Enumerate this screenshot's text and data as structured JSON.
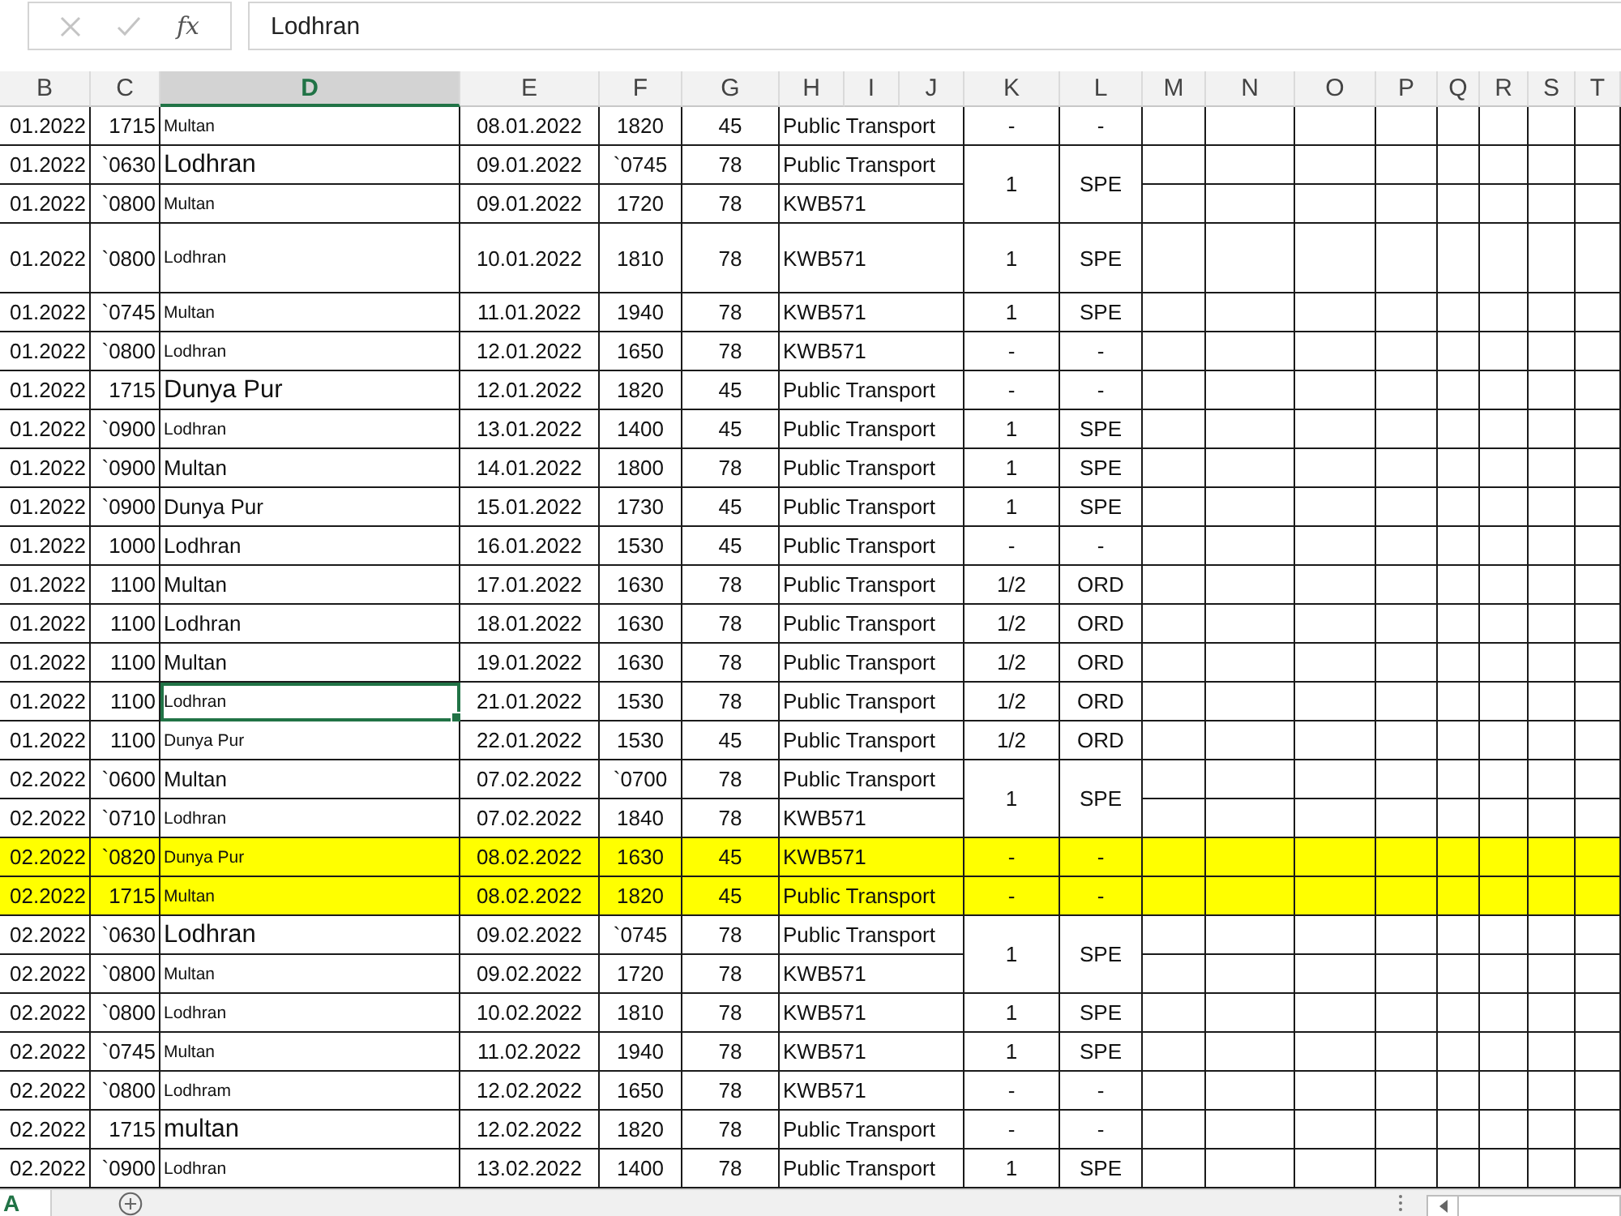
{
  "formula_bar": {
    "function_label": "fx",
    "value": "Lodhran"
  },
  "columns": [
    {
      "label": "B",
      "selected": false
    },
    {
      "label": "C",
      "selected": false
    },
    {
      "label": "D",
      "selected": true
    },
    {
      "label": "E",
      "selected": false
    },
    {
      "label": "F",
      "selected": false
    },
    {
      "label": "G",
      "selected": false
    },
    {
      "label": "H",
      "selected": false
    },
    {
      "label": "I",
      "selected": false
    },
    {
      "label": "J",
      "selected": false
    },
    {
      "label": "K",
      "selected": false
    },
    {
      "label": "L",
      "selected": false
    },
    {
      "label": "M",
      "selected": false
    },
    {
      "label": "N",
      "selected": false
    },
    {
      "label": "O",
      "selected": false
    },
    {
      "label": "P",
      "selected": false
    },
    {
      "label": "Q",
      "selected": false
    },
    {
      "label": "R",
      "selected": false
    },
    {
      "label": "S",
      "selected": false
    },
    {
      "label": "T",
      "selected": false
    }
  ],
  "rows": [
    {
      "b": "01.2022",
      "c": "1715",
      "d": "Multan",
      "kind": "small",
      "e": "08.01.2022",
      "f": "1820",
      "g": "45",
      "h": "Public Transport",
      "k": "-",
      "l": "-",
      "kl_merged": false,
      "tall": false,
      "highlighted": false,
      "selected": false
    },
    {
      "b": "01.2022",
      "c": "`0630",
      "d": "Lodhran",
      "kind": "large",
      "e": "09.01.2022",
      "f": "`0745",
      "g": "78",
      "h": "Public Transport",
      "k": "1",
      "l": "SPE",
      "kl_merged": true,
      "tall": false,
      "highlighted": false,
      "selected": false
    },
    {
      "b": "01.2022",
      "c": "`0800",
      "d": "Multan",
      "kind": "small",
      "e": "09.01.2022",
      "f": "1720",
      "g": "78",
      "h": "KWB571",
      "kl_merged": false,
      "tall": false,
      "highlighted": false,
      "selected": false
    },
    {
      "b": "01.2022",
      "c": "`0800",
      "d": "Lodhran",
      "kind": "small",
      "e": "10.01.2022",
      "f": "1810",
      "g": "78",
      "h": "KWB571",
      "k": "1",
      "l": "SPE",
      "kl_merged": false,
      "tall": true,
      "highlighted": false,
      "selected": false
    },
    {
      "b": "01.2022",
      "c": "`0745",
      "d": "Multan",
      "kind": "small",
      "e": "11.01.2022",
      "f": "1940",
      "g": "78",
      "h": "KWB571",
      "k": "1",
      "l": "SPE",
      "kl_merged": false,
      "tall": false,
      "highlighted": false,
      "selected": false
    },
    {
      "b": "01.2022",
      "c": "`0800",
      "d": "Lodhran",
      "kind": "small",
      "e": "12.01.2022",
      "f": "1650",
      "g": "78",
      "h": "KWB571",
      "k": "-",
      "l": "-",
      "kl_merged": false,
      "tall": false,
      "highlighted": false,
      "selected": false
    },
    {
      "b": "01.2022",
      "c": "1715",
      "d": "Dunya Pur",
      "kind": "large",
      "e": "12.01.2022",
      "f": "1820",
      "g": "45",
      "h": "Public Transport",
      "k": "-",
      "l": "-",
      "kl_merged": false,
      "tall": false,
      "highlighted": false,
      "selected": false
    },
    {
      "b": "01.2022",
      "c": "`0900",
      "d": "Lodhran",
      "kind": "small",
      "e": "13.01.2022",
      "f": "1400",
      "g": "45",
      "h": "Public Transport",
      "k": "1",
      "l": "SPE",
      "kl_merged": false,
      "tall": false,
      "highlighted": false,
      "selected": false
    },
    {
      "b": "01.2022",
      "c": "`0900",
      "d": "Multan",
      "kind": "normal",
      "e": "14.01.2022",
      "f": "1800",
      "g": "78",
      "h": "Public Transport",
      "k": "1",
      "l": "SPE",
      "kl_merged": false,
      "tall": false,
      "highlighted": false,
      "selected": false
    },
    {
      "b": "01.2022",
      "c": "`0900",
      "d": "Dunya Pur",
      "kind": "normal",
      "e": "15.01.2022",
      "f": "1730",
      "g": "45",
      "h": "Public Transport",
      "k": "1",
      "l": "SPE",
      "kl_merged": false,
      "tall": false,
      "highlighted": false,
      "selected": false
    },
    {
      "b": "01.2022",
      "c": "1000",
      "d": "Lodhran",
      "kind": "normal",
      "e": "16.01.2022",
      "f": "1530",
      "g": "45",
      "h": "Public Transport",
      "k": "-",
      "l": "-",
      "kl_merged": false,
      "tall": false,
      "highlighted": false,
      "selected": false
    },
    {
      "b": "01.2022",
      "c": "1100",
      "d": "Multan",
      "kind": "normal",
      "e": "17.01.2022",
      "f": "1630",
      "g": "78",
      "h": "Public Transport",
      "k": "1/2",
      "l": "ORD",
      "kl_merged": false,
      "tall": false,
      "highlighted": false,
      "selected": false
    },
    {
      "b": "01.2022",
      "c": "1100",
      "d": "Lodhran",
      "kind": "normal",
      "e": "18.01.2022",
      "f": "1630",
      "g": "78",
      "h": "Public Transport",
      "k": "1/2",
      "l": "ORD",
      "kl_merged": false,
      "tall": false,
      "highlighted": false,
      "selected": false
    },
    {
      "b": "01.2022",
      "c": "1100",
      "d": "Multan",
      "kind": "normal",
      "e": "19.01.2022",
      "f": "1630",
      "g": "78",
      "h": "Public Transport",
      "k": "1/2",
      "l": "ORD",
      "kl_merged": false,
      "tall": false,
      "highlighted": false,
      "selected": false
    },
    {
      "b": "01.2022",
      "c": "1100",
      "d": "Lodhran",
      "kind": "small",
      "e": "21.01.2022",
      "f": "1530",
      "g": "78",
      "h": "Public Transport",
      "k": "1/2",
      "l": "ORD",
      "kl_merged": false,
      "tall": false,
      "highlighted": false,
      "selected": true
    },
    {
      "b": "01.2022",
      "c": "1100",
      "d": "Dunya Pur",
      "kind": "small",
      "e": "22.01.2022",
      "f": "1530",
      "g": "45",
      "h": "Public Transport",
      "k": "1/2",
      "l": "ORD",
      "kl_merged": false,
      "tall": false,
      "highlighted": false,
      "selected": false
    },
    {
      "b": "02.2022",
      "c": "`0600",
      "d": "Multan",
      "kind": "normal",
      "e": "07.02.2022",
      "f": "`0700",
      "g": "78",
      "h": "Public Transport",
      "k": "1",
      "l": "SPE",
      "kl_merged": true,
      "tall": false,
      "highlighted": false,
      "selected": false
    },
    {
      "b": "02.2022",
      "c": "`0710",
      "d": "Lodhran",
      "kind": "small",
      "e": "07.02.2022",
      "f": "1840",
      "g": "78",
      "h": "KWB571",
      "kl_merged": false,
      "tall": false,
      "highlighted": false,
      "selected": false
    },
    {
      "b": "02.2022",
      "c": "`0820",
      "d": "Dunya Pur",
      "kind": "small",
      "e": "08.02.2022",
      "f": "1630",
      "g": "45",
      "h": "KWB571",
      "k": "-",
      "l": "-",
      "kl_merged": false,
      "tall": false,
      "highlighted": true,
      "selected": false
    },
    {
      "b": "02.2022",
      "c": "1715",
      "d": "Multan",
      "kind": "small",
      "e": "08.02.2022",
      "f": "1820",
      "g": "45",
      "h": "Public Transport",
      "k": "-",
      "l": "-",
      "kl_merged": false,
      "tall": false,
      "highlighted": true,
      "selected": false
    },
    {
      "b": "02.2022",
      "c": "`0630",
      "d": "Lodhran",
      "kind": "large",
      "e": "09.02.2022",
      "f": "`0745",
      "g": "78",
      "h": "Public Transport",
      "k": "1",
      "l": "SPE",
      "kl_merged": true,
      "tall": false,
      "highlighted": false,
      "selected": false
    },
    {
      "b": "02.2022",
      "c": "`0800",
      "d": "Multan",
      "kind": "small",
      "e": "09.02.2022",
      "f": "1720",
      "g": "78",
      "h": "KWB571",
      "kl_merged": false,
      "tall": false,
      "highlighted": false,
      "selected": false
    },
    {
      "b": "02.2022",
      "c": "`0800",
      "d": "Lodhran",
      "kind": "small",
      "e": "10.02.2022",
      "f": "1810",
      "g": "78",
      "h": "KWB571",
      "k": "1",
      "l": "SPE",
      "kl_merged": false,
      "tall": false,
      "highlighted": false,
      "selected": false
    },
    {
      "b": "02.2022",
      "c": "`0745",
      "d": "Multan",
      "kind": "small",
      "e": "11.02.2022",
      "f": "1940",
      "g": "78",
      "h": "KWB571",
      "k": "1",
      "l": "SPE",
      "kl_merged": false,
      "tall": false,
      "highlighted": false,
      "selected": false
    },
    {
      "b": "02.2022",
      "c": "`0800",
      "d": "Lodhram",
      "kind": "small",
      "e": "12.02.2022",
      "f": "1650",
      "g": "78",
      "h": "KWB571",
      "k": "-",
      "l": "-",
      "kl_merged": false,
      "tall": false,
      "highlighted": false,
      "selected": false
    },
    {
      "b": "02.2022",
      "c": "1715",
      "d": "multan",
      "kind": "large",
      "e": "12.02.2022",
      "f": "1820",
      "g": "78",
      "h": "Public Transport",
      "k": "-",
      "l": "-",
      "kl_merged": false,
      "tall": false,
      "highlighted": false,
      "selected": false
    },
    {
      "b": "02.2022",
      "c": "`0900",
      "d": "Lodhran",
      "kind": "small",
      "e": "13.02.2022",
      "f": "1400",
      "g": "78",
      "h": "Public Transport",
      "k": "1",
      "l": "SPE",
      "kl_merged": false,
      "tall": false,
      "highlighted": false,
      "selected": false
    }
  ],
  "sheet_tabs": [
    {
      "label": "A",
      "selected": true
    }
  ]
}
